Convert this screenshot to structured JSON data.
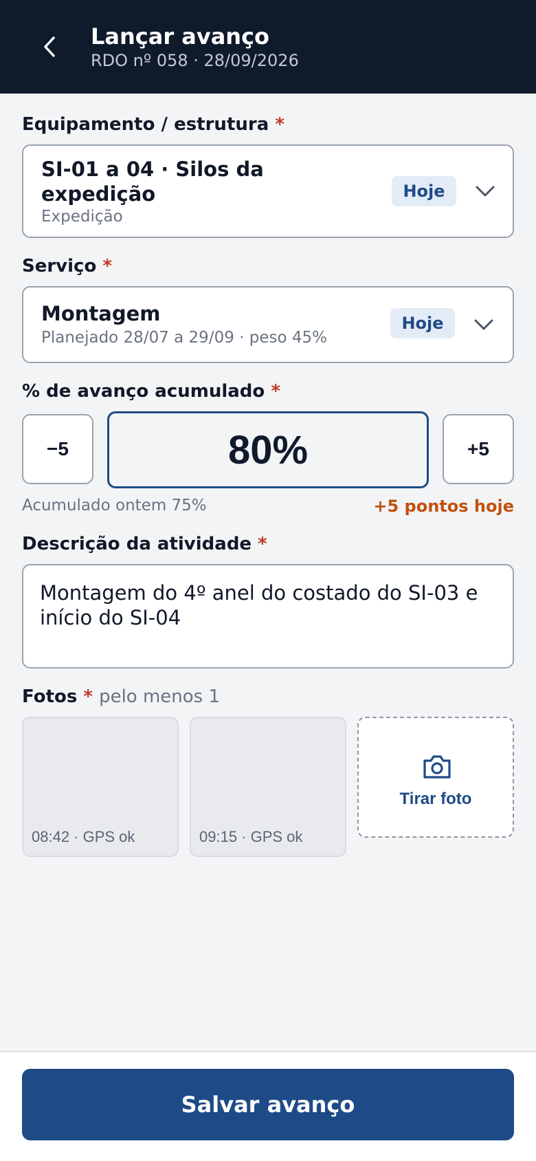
{
  "header": {
    "title": "Lançar avanço",
    "subtitle": "RDO nº 058 · 28/09/2026"
  },
  "equipment": {
    "label": "Equipamento / estrutura",
    "required": "*",
    "value_line1": "SI-01 a 04 · Silos da",
    "value_line2": "expedição",
    "sub": "Expedição",
    "badge": "Hoje"
  },
  "service": {
    "label": "Serviço",
    "required": "*",
    "value": "Montagem",
    "sub": "Planejado 28/07 a 29/09 · peso 45%",
    "badge": "Hoje"
  },
  "progress": {
    "label": "% de avanço acumulado",
    "required": "*",
    "minus_label": "−5",
    "plus_label": "+5",
    "value_text": "80%",
    "value": 80,
    "yesterday_text": "Acumulado ontem 75%",
    "delta_text": "+5 pontos hoje"
  },
  "description": {
    "label": "Descrição da atividade",
    "required": "*",
    "value": "Montagem do 4º anel do costado do SI-03 e início do SI-04"
  },
  "photos": {
    "label": "Fotos",
    "required": "*",
    "hint": "pelo menos 1",
    "items": [
      {
        "caption": "08:42 · GPS ok"
      },
      {
        "caption": "09:15 · GPS ok"
      }
    ],
    "take_photo_label": "Tirar foto"
  },
  "footer": {
    "save_label": "Salvar avanço"
  },
  "colors": {
    "header_bg": "#0f1a2b",
    "accent": "#1e4b86",
    "required": "#c0392b",
    "delta": "#c2510e"
  },
  "icons": [
    "back-arrow-icon",
    "chevron-down-icon",
    "camera-icon"
  ]
}
